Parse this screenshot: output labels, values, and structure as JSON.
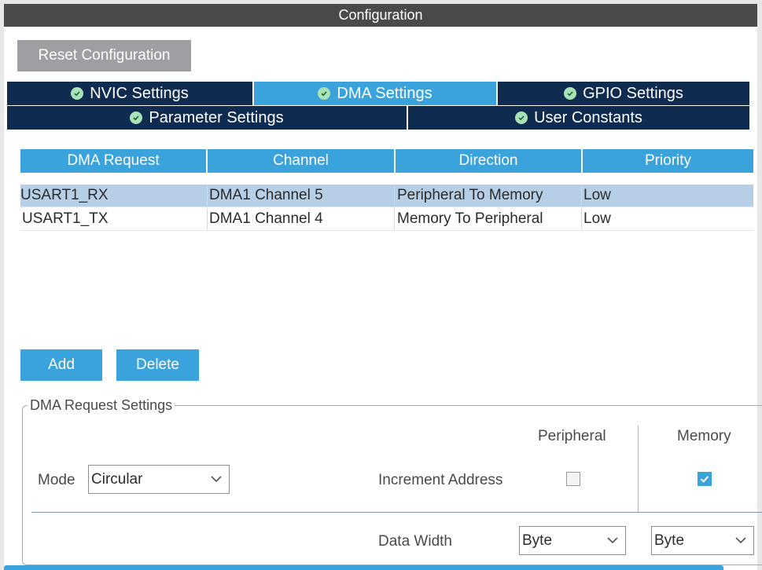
{
  "window": {
    "title": "Configuration"
  },
  "toolbar": {
    "reset_label": "Reset Configuration"
  },
  "tabs": {
    "nvic": "NVIC Settings",
    "dma": "DMA Settings",
    "gpio": "GPIO Settings",
    "parameter": "Parameter Settings",
    "user_constants": "User Constants",
    "active": "DMA Settings",
    "status_icon": "check-circle-icon"
  },
  "table": {
    "headers": [
      "DMA Request",
      "Channel",
      "Direction",
      "Priority"
    ],
    "rows": [
      [
        "USART1_RX",
        "DMA1 Channel 5",
        "Peripheral To Memory",
        "Low"
      ],
      [
        "USART1_TX",
        "DMA1 Channel 4",
        "Memory To Peripheral",
        "Low"
      ]
    ],
    "selected_row": 0
  },
  "actions": {
    "add": "Add",
    "delete": "Delete"
  },
  "settings": {
    "group_title": "DMA Request Settings",
    "peripheral_header": "Peripheral",
    "memory_header": "Memory",
    "mode_label": "Mode",
    "mode_value": "Circular",
    "increment_label": "Increment Address",
    "peripheral_increment": false,
    "memory_increment": true,
    "data_width_label": "Data Width",
    "peripheral_width": "Byte",
    "memory_width": "Byte"
  },
  "colors": {
    "accent": "#3aa3dc",
    "tab_bg": "#0f2b4f",
    "title_bar": "#4a4a4a",
    "selected_row": "#b7cfe6",
    "reset_button": "#9d9fa2"
  }
}
